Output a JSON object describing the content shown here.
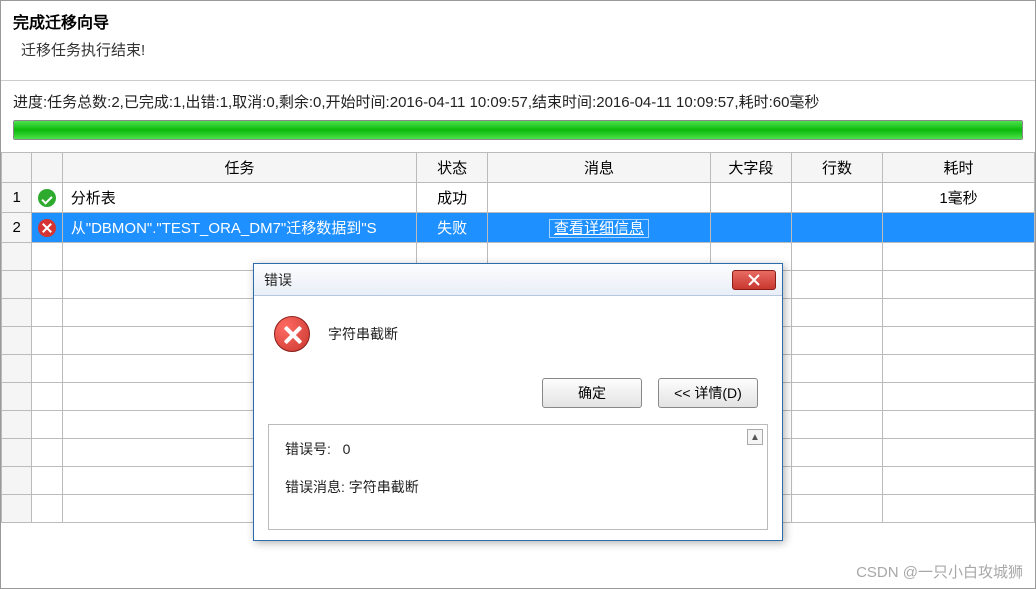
{
  "header": {
    "title": "完成迁移向导",
    "subtitle": "迁移任务执行结束!"
  },
  "progress": {
    "text": "进度:任务总数:2,已完成:1,出错:1,取消:0,剩余:0,开始时间:2016-04-11 10:09:57,结束时间:2016-04-11 10:09:57,耗时:60毫秒"
  },
  "table": {
    "headers": {
      "task": "任务",
      "status": "状态",
      "message": "消息",
      "lob": "大字段",
      "rows": "行数",
      "time": "耗时"
    },
    "rows": [
      {
        "num": "1",
        "icon": "success",
        "task": "分析表",
        "status": "成功",
        "message": "",
        "lob": "",
        "rows": "",
        "time": "1毫秒"
      },
      {
        "num": "2",
        "icon": "error",
        "task": "从\"DBMON\".\"TEST_ORA_DM7\"迁移数据到\"S",
        "status": "失败",
        "message": "查看详细信息",
        "lob": "",
        "rows": "",
        "time": ""
      }
    ]
  },
  "dialog": {
    "title": "错误",
    "message": "字符串截断",
    "buttons": {
      "ok": "确定",
      "details": "<< 详情(D)"
    },
    "details": {
      "error_no_label": "错误号:",
      "error_no": "0",
      "error_msg_label": "错误消息:",
      "error_msg": "字符串截断"
    }
  },
  "watermark": "CSDN @一只小白攻城狮"
}
